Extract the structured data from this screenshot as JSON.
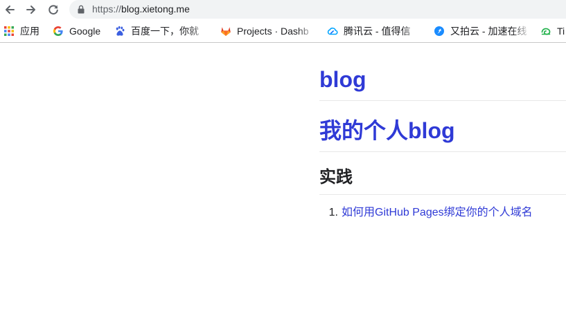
{
  "browser": {
    "url_scheme": "https://",
    "url_host": "blog.xietong.me",
    "bookmarks": [
      {
        "label": "应用",
        "icon": "apps-grid-icon"
      },
      {
        "label": "Google",
        "icon": "google-icon"
      },
      {
        "label": "百度一下，你就",
        "icon": "baidu-paw-icon"
      },
      {
        "label": "Projects · Dashb",
        "icon": "gitlab-fox-icon"
      },
      {
        "label": "腾讯云 - 值得信",
        "icon": "tencent-cloud-icon"
      },
      {
        "label": "又拍云 - 加速在线",
        "icon": "upyun-icon"
      },
      {
        "label": "Ti",
        "icon": "green-swirl-icon"
      }
    ]
  },
  "page": {
    "title": "blog",
    "subtitle": "我的个人blog",
    "section": "实践",
    "articles": [
      {
        "number": "1.",
        "title": "如何用GitHub Pages绑定你的个人域名"
      }
    ]
  },
  "colors": {
    "link": "#2f3ad6",
    "heading": "#202124",
    "omnibox": "#f1f3f4"
  }
}
